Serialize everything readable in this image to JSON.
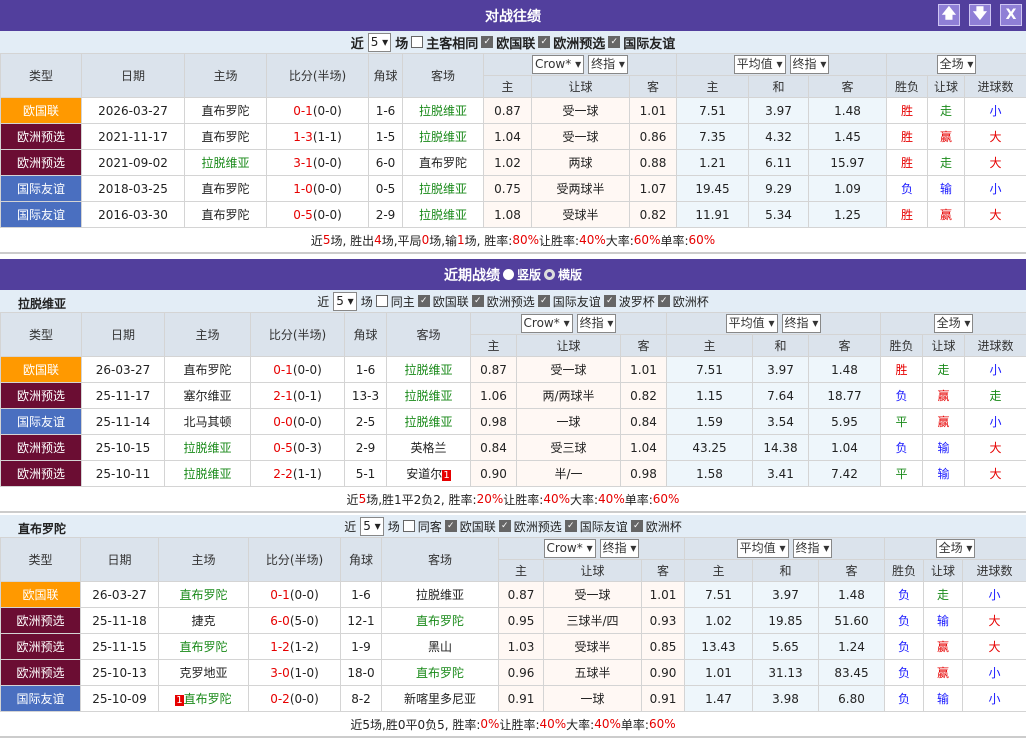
{
  "colors": {
    "header": "#523f9d",
    "欧国联": "#ff9900",
    "欧洲预选": "#6b0d33",
    "国际友谊": "#4a6fc0"
  },
  "h2h": {
    "title": "对战往绩",
    "buttons": [
      {
        "icon": "arrow-up-icon",
        "glyph": "🡅"
      },
      {
        "icon": "arrow-down-icon",
        "glyph": "🡇"
      },
      {
        "icon": "close-icon",
        "glyph": "X"
      }
    ],
    "filter": {
      "prefix": "近",
      "count": "5",
      "suffix": "场",
      "same": "主客相同",
      "leagues": [
        "欧国联",
        "欧洲预选",
        "国际友谊"
      ]
    },
    "summary": [
      [
        "近 ",
        ""
      ],
      [
        "5",
        "r"
      ],
      [
        " 场, 胜出 ",
        ""
      ],
      [
        "4",
        "r"
      ],
      [
        " 场,平局 ",
        ""
      ],
      [
        "0",
        "r"
      ],
      [
        " 场,输 ",
        ""
      ],
      [
        "1",
        "r"
      ],
      [
        " 场, 胜率: ",
        ""
      ],
      [
        "80%",
        "r"
      ],
      [
        " 让胜率: ",
        ""
      ],
      [
        "40%",
        "r"
      ],
      [
        " 大率: ",
        ""
      ],
      [
        "60%",
        "r"
      ],
      [
        " 单率: ",
        ""
      ],
      [
        "60%",
        "r"
      ]
    ],
    "rows": [
      [
        "欧国联",
        "2026-03-27",
        "直布罗陀",
        "0-1",
        "(0-0)",
        "1-6",
        "拉脱维亚",
        "0.87",
        "受一球",
        "1.01",
        "7.51",
        "3.97",
        "1.48",
        "胜",
        "走",
        "小"
      ],
      [
        "欧洲预选",
        "2021-11-17",
        "直布罗陀",
        "1-3",
        "(1-1)",
        "1-5",
        "拉脱维亚",
        "1.04",
        "受一球",
        "0.86",
        "7.35",
        "4.32",
        "1.45",
        "胜",
        "赢",
        "大"
      ],
      [
        "欧洲预选",
        "2021-09-02",
        "拉脱维亚",
        "3-1",
        "(0-0)",
        "6-0",
        "直布罗陀",
        "1.02",
        "两球",
        "0.88",
        "1.21",
        "6.11",
        "15.97",
        "胜",
        "走",
        "大"
      ],
      [
        "国际友谊",
        "2018-03-25",
        "直布罗陀",
        "1-0",
        "(0-0)",
        "0-5",
        "拉脱维亚",
        "0.75",
        "受两球半",
        "1.07",
        "19.45",
        "9.29",
        "1.09",
        "负",
        "输",
        "小"
      ],
      [
        "国际友谊",
        "2016-03-30",
        "直布罗陀",
        "0-5",
        "(0-0)",
        "2-9",
        "拉脱维亚",
        "1.08",
        "受球半",
        "0.82",
        "11.91",
        "5.34",
        "1.25",
        "胜",
        "赢",
        "大"
      ]
    ],
    "green": "拉脱维亚"
  },
  "headers": {
    "type": "类型",
    "date": "日期",
    "home": "主场",
    "score": "比分(半场)",
    "corner": "角球",
    "away": "客场",
    "crow": "Crow*",
    "final": "终指",
    "avg": "平均值",
    "full": "全场",
    "h": "主",
    "hc": "让球",
    "a": "客",
    "d": "和",
    "wl": "胜负",
    "hcr": "让球",
    "goals": "进球数"
  },
  "recent": {
    "title": "近期战绩",
    "opt1": "竖版",
    "opt2": "横版"
  },
  "latvia": {
    "team": "拉脱维亚",
    "filter": {
      "prefix": "近",
      "count": "5",
      "suffix": "场",
      "same": "同主",
      "leagues": [
        "欧国联",
        "欧洲预选",
        "国际友谊",
        "波罗杯",
        "欧洲杯"
      ]
    },
    "summary": [
      [
        "近",
        ""
      ],
      [
        "5",
        "r"
      ],
      [
        "场,胜1平2负2, 胜率:",
        ""
      ],
      [
        "20%",
        "r"
      ],
      [
        " 让胜率:",
        ""
      ],
      [
        "40%",
        "r"
      ],
      [
        " 大率:",
        ""
      ],
      [
        "40%",
        "r"
      ],
      [
        " 单率:",
        ""
      ],
      [
        "60%",
        "r"
      ]
    ],
    "rows": [
      [
        "欧国联",
        "26-03-27",
        "直布罗陀",
        "0-1",
        "(0-0)",
        "1-6",
        "拉脱维亚",
        "0.87",
        "受一球",
        "1.01",
        "7.51",
        "3.97",
        "1.48",
        "胜",
        "走",
        "小"
      ],
      [
        "欧洲预选",
        "25-11-17",
        "塞尔维亚",
        "2-1",
        "(0-1)",
        "13-3",
        "拉脱维亚",
        "1.06",
        "两/两球半",
        "0.82",
        "1.15",
        "7.64",
        "18.77",
        "负",
        "赢",
        "走"
      ],
      [
        "国际友谊",
        "25-11-14",
        "北马其顿",
        "0-0",
        "(0-0)",
        "2-5",
        "拉脱维亚",
        "0.98",
        "一球",
        "0.84",
        "1.59",
        "3.54",
        "5.95",
        "平",
        "赢",
        "小"
      ],
      [
        "欧洲预选",
        "25-10-15",
        "拉脱维亚",
        "0-5",
        "(0-3)",
        "2-9",
        "英格兰",
        "0.84",
        "受三球",
        "1.04",
        "43.25",
        "14.38",
        "1.04",
        "负",
        "输",
        "大"
      ],
      [
        "欧洲预选",
        "25-10-11",
        "拉脱维亚",
        "2-2",
        "(1-1)",
        "5-1",
        "安道尔",
        "0.90",
        "半/一",
        "0.98",
        "1.58",
        "3.41",
        "7.42",
        "平",
        "输",
        "大"
      ]
    ],
    "red_cards": {
      "4": {
        "side": "away",
        "n": "1"
      }
    },
    "green": "拉脱维亚"
  },
  "gibraltar": {
    "team": "直布罗陀",
    "filter": {
      "prefix": "近",
      "count": "5",
      "suffix": "场",
      "same": "同客",
      "leagues": [
        "欧国联",
        "欧洲预选",
        "国际友谊",
        "欧洲杯"
      ]
    },
    "summary": [
      [
        "近5场,胜0平0负5, 胜率:",
        ""
      ],
      [
        "0%",
        "r"
      ],
      [
        " 让胜率:",
        ""
      ],
      [
        "40%",
        "r"
      ],
      [
        " 大率:",
        ""
      ],
      [
        "40%",
        "r"
      ],
      [
        " 单率:",
        ""
      ],
      [
        "60%",
        "r"
      ]
    ],
    "rows": [
      [
        "欧国联",
        "26-03-27",
        "直布罗陀",
        "0-1",
        "(0-0)",
        "1-6",
        "拉脱维亚",
        "0.87",
        "受一球",
        "1.01",
        "7.51",
        "3.97",
        "1.48",
        "负",
        "走",
        "小"
      ],
      [
        "欧洲预选",
        "25-11-18",
        "捷克",
        "6-0",
        "(5-0)",
        "12-1",
        "直布罗陀",
        "0.95",
        "三球半/四",
        "0.93",
        "1.02",
        "19.85",
        "51.60",
        "负",
        "输",
        "大"
      ],
      [
        "欧洲预选",
        "25-11-15",
        "直布罗陀",
        "1-2",
        "(1-2)",
        "1-9",
        "黑山",
        "1.03",
        "受球半",
        "0.85",
        "13.43",
        "5.65",
        "1.24",
        "负",
        "赢",
        "大"
      ],
      [
        "欧洲预选",
        "25-10-13",
        "克罗地亚",
        "3-0",
        "(1-0)",
        "18-0",
        "直布罗陀",
        "0.96",
        "五球半",
        "0.90",
        "1.01",
        "31.13",
        "83.45",
        "负",
        "赢",
        "小"
      ],
      [
        "国际友谊",
        "25-10-09",
        "直布罗陀",
        "0-2",
        "(0-0)",
        "8-2",
        "新喀里多尼亚",
        "0.91",
        "一球",
        "0.91",
        "1.47",
        "3.98",
        "6.80",
        "负",
        "输",
        "小"
      ]
    ],
    "red_cards": {
      "4": {
        "side": "home",
        "n": "1"
      }
    },
    "green": "直布罗陀"
  }
}
